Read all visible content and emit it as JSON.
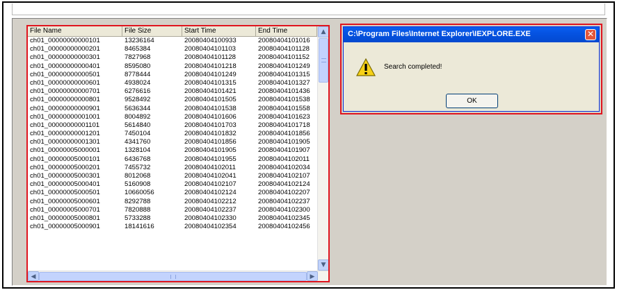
{
  "list": {
    "columns": [
      "File Name",
      "File Size",
      "Start Time",
      "End Time"
    ],
    "rows": [
      [
        "ch01_00000000000101",
        "13236164",
        "20080404100933",
        "20080404101016"
      ],
      [
        "ch01_00000000000201",
        "8465384",
        "20080404101103",
        "20080404101128"
      ],
      [
        "ch01_00000000000301",
        "7827968",
        "20080404101128",
        "20080404101152"
      ],
      [
        "ch01_00000000000401",
        "8595080",
        "20080404101218",
        "20080404101249"
      ],
      [
        "ch01_00000000000501",
        "8778444",
        "20080404101249",
        "20080404101315"
      ],
      [
        "ch01_00000000000601",
        "4938024",
        "20080404101315",
        "20080404101327"
      ],
      [
        "ch01_00000000000701",
        "6276616",
        "20080404101421",
        "20080404101436"
      ],
      [
        "ch01_00000000000801",
        "9528492",
        "20080404101505",
        "20080404101538"
      ],
      [
        "ch01_00000000000901",
        "5636344",
        "20080404101538",
        "20080404101558"
      ],
      [
        "ch01_00000000001001",
        "8004892",
        "20080404101606",
        "20080404101623"
      ],
      [
        "ch01_00000000001101",
        "5614840",
        "20080404101703",
        "20080404101718"
      ],
      [
        "ch01_00000000001201",
        "7450104",
        "20080404101832",
        "20080404101856"
      ],
      [
        "ch01_00000000001301",
        "4341760",
        "20080404101856",
        "20080404101905"
      ],
      [
        "ch01_00000005000001",
        "1328104",
        "20080404101905",
        "20080404101907"
      ],
      [
        "ch01_00000005000101",
        "6436768",
        "20080404101955",
        "20080404102011"
      ],
      [
        "ch01_00000005000201",
        "7455732",
        "20080404102011",
        "20080404102034"
      ],
      [
        "ch01_00000005000301",
        "8012068",
        "20080404102041",
        "20080404102107"
      ],
      [
        "ch01_00000005000401",
        "5160908",
        "20080404102107",
        "20080404102124"
      ],
      [
        "ch01_00000005000501",
        "10660056",
        "20080404102124",
        "20080404102207"
      ],
      [
        "ch01_00000005000601",
        "8292788",
        "20080404102212",
        "20080404102237"
      ],
      [
        "ch01_00000005000701",
        "7820888",
        "20080404102237",
        "20080404102300"
      ],
      [
        "ch01_00000005000801",
        "5733288",
        "20080404102330",
        "20080404102345"
      ],
      [
        "ch01_00000005000901",
        "18141616",
        "20080404102354",
        "20080404102456"
      ]
    ]
  },
  "dialog": {
    "title": "C:\\Program Files\\Internet Explorer\\IEXPLORE.EXE",
    "message": "Search completed!",
    "ok_label": "OK",
    "close_glyph": "✕"
  },
  "icons": {
    "warning": "warning-icon",
    "scroll_up": "▲",
    "scroll_down": "▼",
    "scroll_left": "◀",
    "scroll_right": "▶"
  },
  "colors": {
    "highlight": "#e0141e",
    "titlebar": "#0553e2"
  }
}
